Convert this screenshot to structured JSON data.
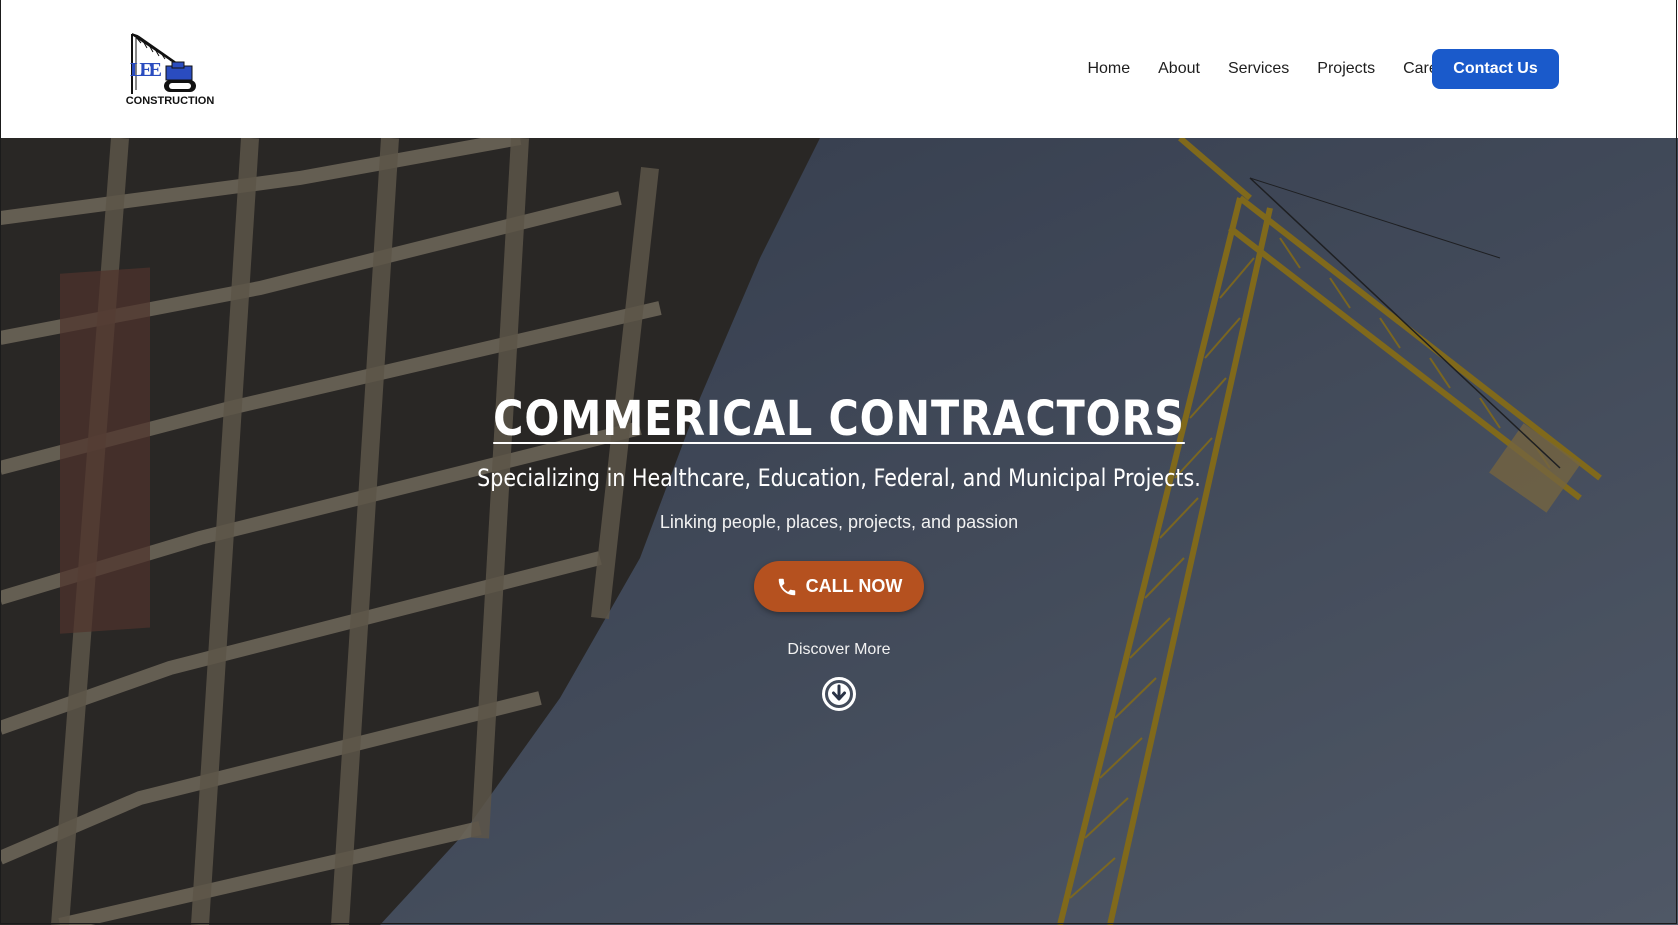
{
  "brand": {
    "logo_text": "CONSTRUCTION",
    "logo_letters": "LEE",
    "logo_color": "#2a4cbf"
  },
  "nav": {
    "items": [
      {
        "label": "Home"
      },
      {
        "label": "About"
      },
      {
        "label": "Services"
      },
      {
        "label": "Projects"
      },
      {
        "label": "Careers"
      }
    ],
    "contact_label": "Contact Us",
    "contact_color": "#1a5acb"
  },
  "hero": {
    "title": "COMMERICAL CONTRACTORS",
    "subtitle": "Specializing in Healthcare, Education, Federal, and Municipal Projects.",
    "tagline": "Linking people, places, projects, and passion",
    "call_label": "CALL NOW",
    "call_color": "#b5511f",
    "discover_label": "Discover More",
    "call_icon": "phone-icon",
    "discover_icon": "arrow-down-circle-icon"
  }
}
